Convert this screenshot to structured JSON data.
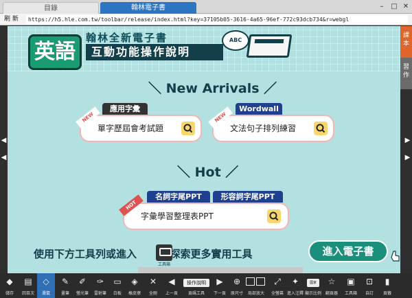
{
  "browser": {
    "tabs": [
      {
        "label": "目錄",
        "active": false
      },
      {
        "label": "翰林電子書",
        "active": true
      }
    ],
    "refresh_label": "刷 新",
    "url": "https://h5.hle.com.tw/toolbar/release/index.html?key=37105b05-3616-4a65-96ef-772c93dcb734&r=webgl"
  },
  "header": {
    "subject": "英語",
    "brand": "翰林全新電子書",
    "title": "互動功能操作說明",
    "bubble_text": "ABC"
  },
  "sections": [
    {
      "heading": "＼ New Arrivals ／",
      "cards": [
        {
          "ribbon": "NEW",
          "tags": [
            {
              "label": "應用字彙",
              "color": "#333333"
            }
          ],
          "text": "單字歷屆會考試題",
          "action_icon": "search-icon"
        },
        {
          "ribbon": "NEW",
          "tags": [
            {
              "label": "Wordwall",
              "color": "#1f3f8f"
            }
          ],
          "text": "文法句子排列練習",
          "action_icon": "search-icon"
        }
      ]
    },
    {
      "heading": "＼ Hot ／",
      "cards": [
        {
          "ribbon": "HOT",
          "tags": [
            {
              "label": "名詞字尾PPT",
              "color": "#1f3f8f"
            },
            {
              "label": "形容詞字尾PPT",
              "color": "#1f3f8f"
            }
          ],
          "text": "字彙學習整理表PPT",
          "action_icon": "search-icon"
        }
      ]
    }
  ],
  "footer_note": {
    "before": "使用下方工具列或進入",
    "toolbox_label": "工具箱",
    "after": "探索更多實用工具"
  },
  "enter_button": "進入電子書",
  "side_tabs": [
    "課本",
    "習作"
  ],
  "toolbar": {
    "items": [
      {
        "label": "儲存",
        "icon": "save-icon",
        "glyph": "◆"
      },
      {
        "label": "回目次",
        "icon": "toc-icon",
        "glyph": "▤"
      },
      {
        "label": "滑鼠",
        "icon": "pointer-icon",
        "glyph": "◇",
        "selected": true
      },
      {
        "label": "畫筆",
        "icon": "pen-icon",
        "glyph": "✎"
      },
      {
        "label": "螢光筆",
        "icon": "highlighter-icon",
        "glyph": "✐"
      },
      {
        "label": "雷射筆",
        "icon": "laser-icon",
        "glyph": "✑"
      },
      {
        "label": "白板",
        "icon": "whiteboard-icon",
        "glyph": "▭"
      },
      {
        "label": "橡皮擦",
        "icon": "eraser-icon",
        "glyph": "◈"
      },
      {
        "label": "全刪",
        "icon": "trash-icon",
        "glyph": "✕"
      },
      {
        "label": "上一頁",
        "icon": "prev-page-icon",
        "glyph": "◀"
      },
      {
        "label": "頁碼工具",
        "icon": "page-tool-icon",
        "glyph": ""
      },
      {
        "label": "下一頁",
        "icon": "next-page-icon",
        "glyph": "▶"
      },
      {
        "label": "原尺寸",
        "icon": "zoom-icon",
        "glyph": "⊕"
      },
      {
        "label": "局部放大",
        "icon": "partial-zoom-icon",
        "glyph": "⊞"
      },
      {
        "label": "全螢幕",
        "icon": "fullscreen-icon",
        "glyph": "⤢"
      },
      {
        "label": "進入注釋",
        "icon": "annotation-icon",
        "glyph": "✦"
      },
      {
        "label": "顯示比例",
        "icon": "scale-icon",
        "glyph": "▦"
      },
      {
        "label": "翻頁器",
        "icon": "page-flipper-icon",
        "glyph": "☆"
      },
      {
        "label": "工具箱",
        "icon": "toolbox-icon",
        "glyph": "▣"
      },
      {
        "label": "自訂",
        "icon": "custom-icon",
        "glyph": "⊡"
      },
      {
        "label": "頁籤",
        "icon": "bookmark-icon",
        "glyph": "▮"
      }
    ],
    "page_info_label": "操作說明",
    "scale_box_label": "",
    "next_label_box": "國家"
  }
}
